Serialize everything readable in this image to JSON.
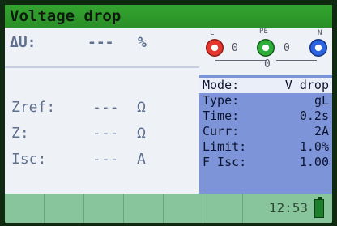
{
  "title": "Voltage drop",
  "result": {
    "du_symbol": "ΔU:",
    "du_value": "---",
    "du_unit": "%"
  },
  "measurements": [
    {
      "label": "Zref:",
      "value": "---",
      "unit": "Ω"
    },
    {
      "label": "Z:",
      "value": "---",
      "unit": "Ω"
    },
    {
      "label": "Isc:",
      "value": "---",
      "unit": "A"
    }
  ],
  "terminals": {
    "L": {
      "label": "L",
      "value": "0",
      "color": "#e5372e"
    },
    "PE": {
      "label": "PE",
      "value": "0",
      "color": "#2fae3a"
    },
    "N": {
      "label": "N",
      "value": "",
      "color": "#2b63e0"
    },
    "LN_value": "0",
    "PEN_value": "0"
  },
  "params": [
    {
      "key": "Mode:",
      "value": "V drop"
    },
    {
      "key": "Type:",
      "value": "gL"
    },
    {
      "key": "Time:",
      "value": "0.2s"
    },
    {
      "key": "Curr:",
      "value": "2A"
    },
    {
      "key": "Limit:",
      "value": "1.0%"
    },
    {
      "key": "F Isc:",
      "value": "1.00"
    }
  ],
  "status": {
    "time": "12:53",
    "battery": "full"
  },
  "colors": {
    "title_bg": "#2e9a2b",
    "panel_bg": "#7e94d8",
    "bottom_bg": "#88c49c"
  }
}
